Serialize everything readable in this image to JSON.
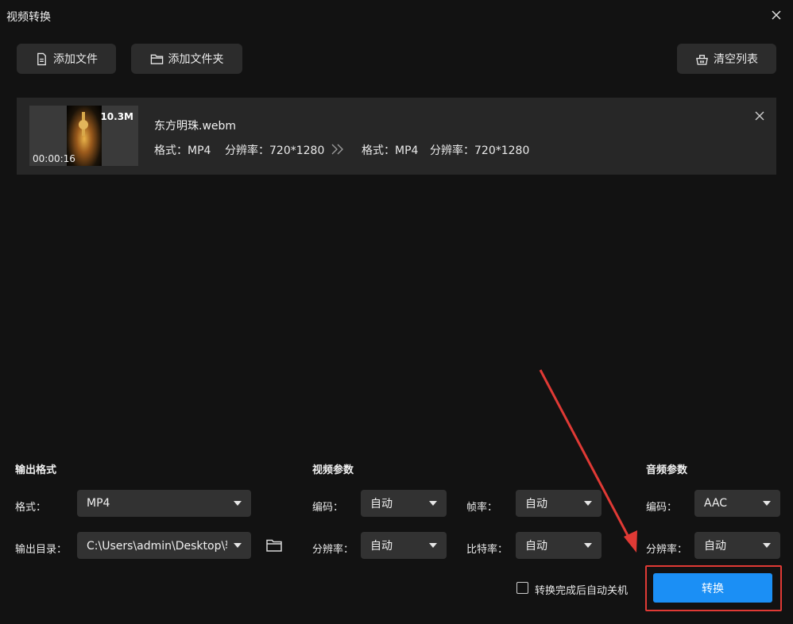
{
  "window": {
    "title": "视频转换"
  },
  "toolbar": {
    "add_file_label": "添加文件",
    "add_folder_label": "添加文件夹",
    "clear_list_label": "清空列表"
  },
  "file": {
    "name": "东方明珠.webm",
    "size": "10.3M",
    "duration": "00:00:16",
    "src_format": "格式：MP4",
    "src_resolution": "分辨率：720*1280",
    "dst_format": "格式：MP4",
    "dst_resolution": "分辨率：720*1280"
  },
  "output": {
    "section_title": "输出格式",
    "format_label": "格式：",
    "format_value": "MP4",
    "dir_label": "输出目录：",
    "dir_value": "C:\\Users\\admin\\Desktop\\转换"
  },
  "video": {
    "section_title": "视频参数",
    "codec_label": "编码：",
    "codec_value": "自动",
    "framerate_label": "帧率：",
    "framerate_value": "自动",
    "resolution_label": "分辨率：",
    "resolution_value": "自动",
    "bitrate_label": "比特率：",
    "bitrate_value": "自动"
  },
  "audio": {
    "section_title": "音频参数",
    "codec_label": "编码：",
    "codec_value": "AAC",
    "resolution_label": "分辨率：",
    "resolution_value": "自动"
  },
  "footer": {
    "shutdown_label": "转换完成后自动关机",
    "shutdown_checked": false,
    "convert_label": "转换"
  },
  "colors": {
    "background": "#121212",
    "card": "#272727",
    "accent": "#1b8ff5",
    "annotation": "#e03a35"
  }
}
